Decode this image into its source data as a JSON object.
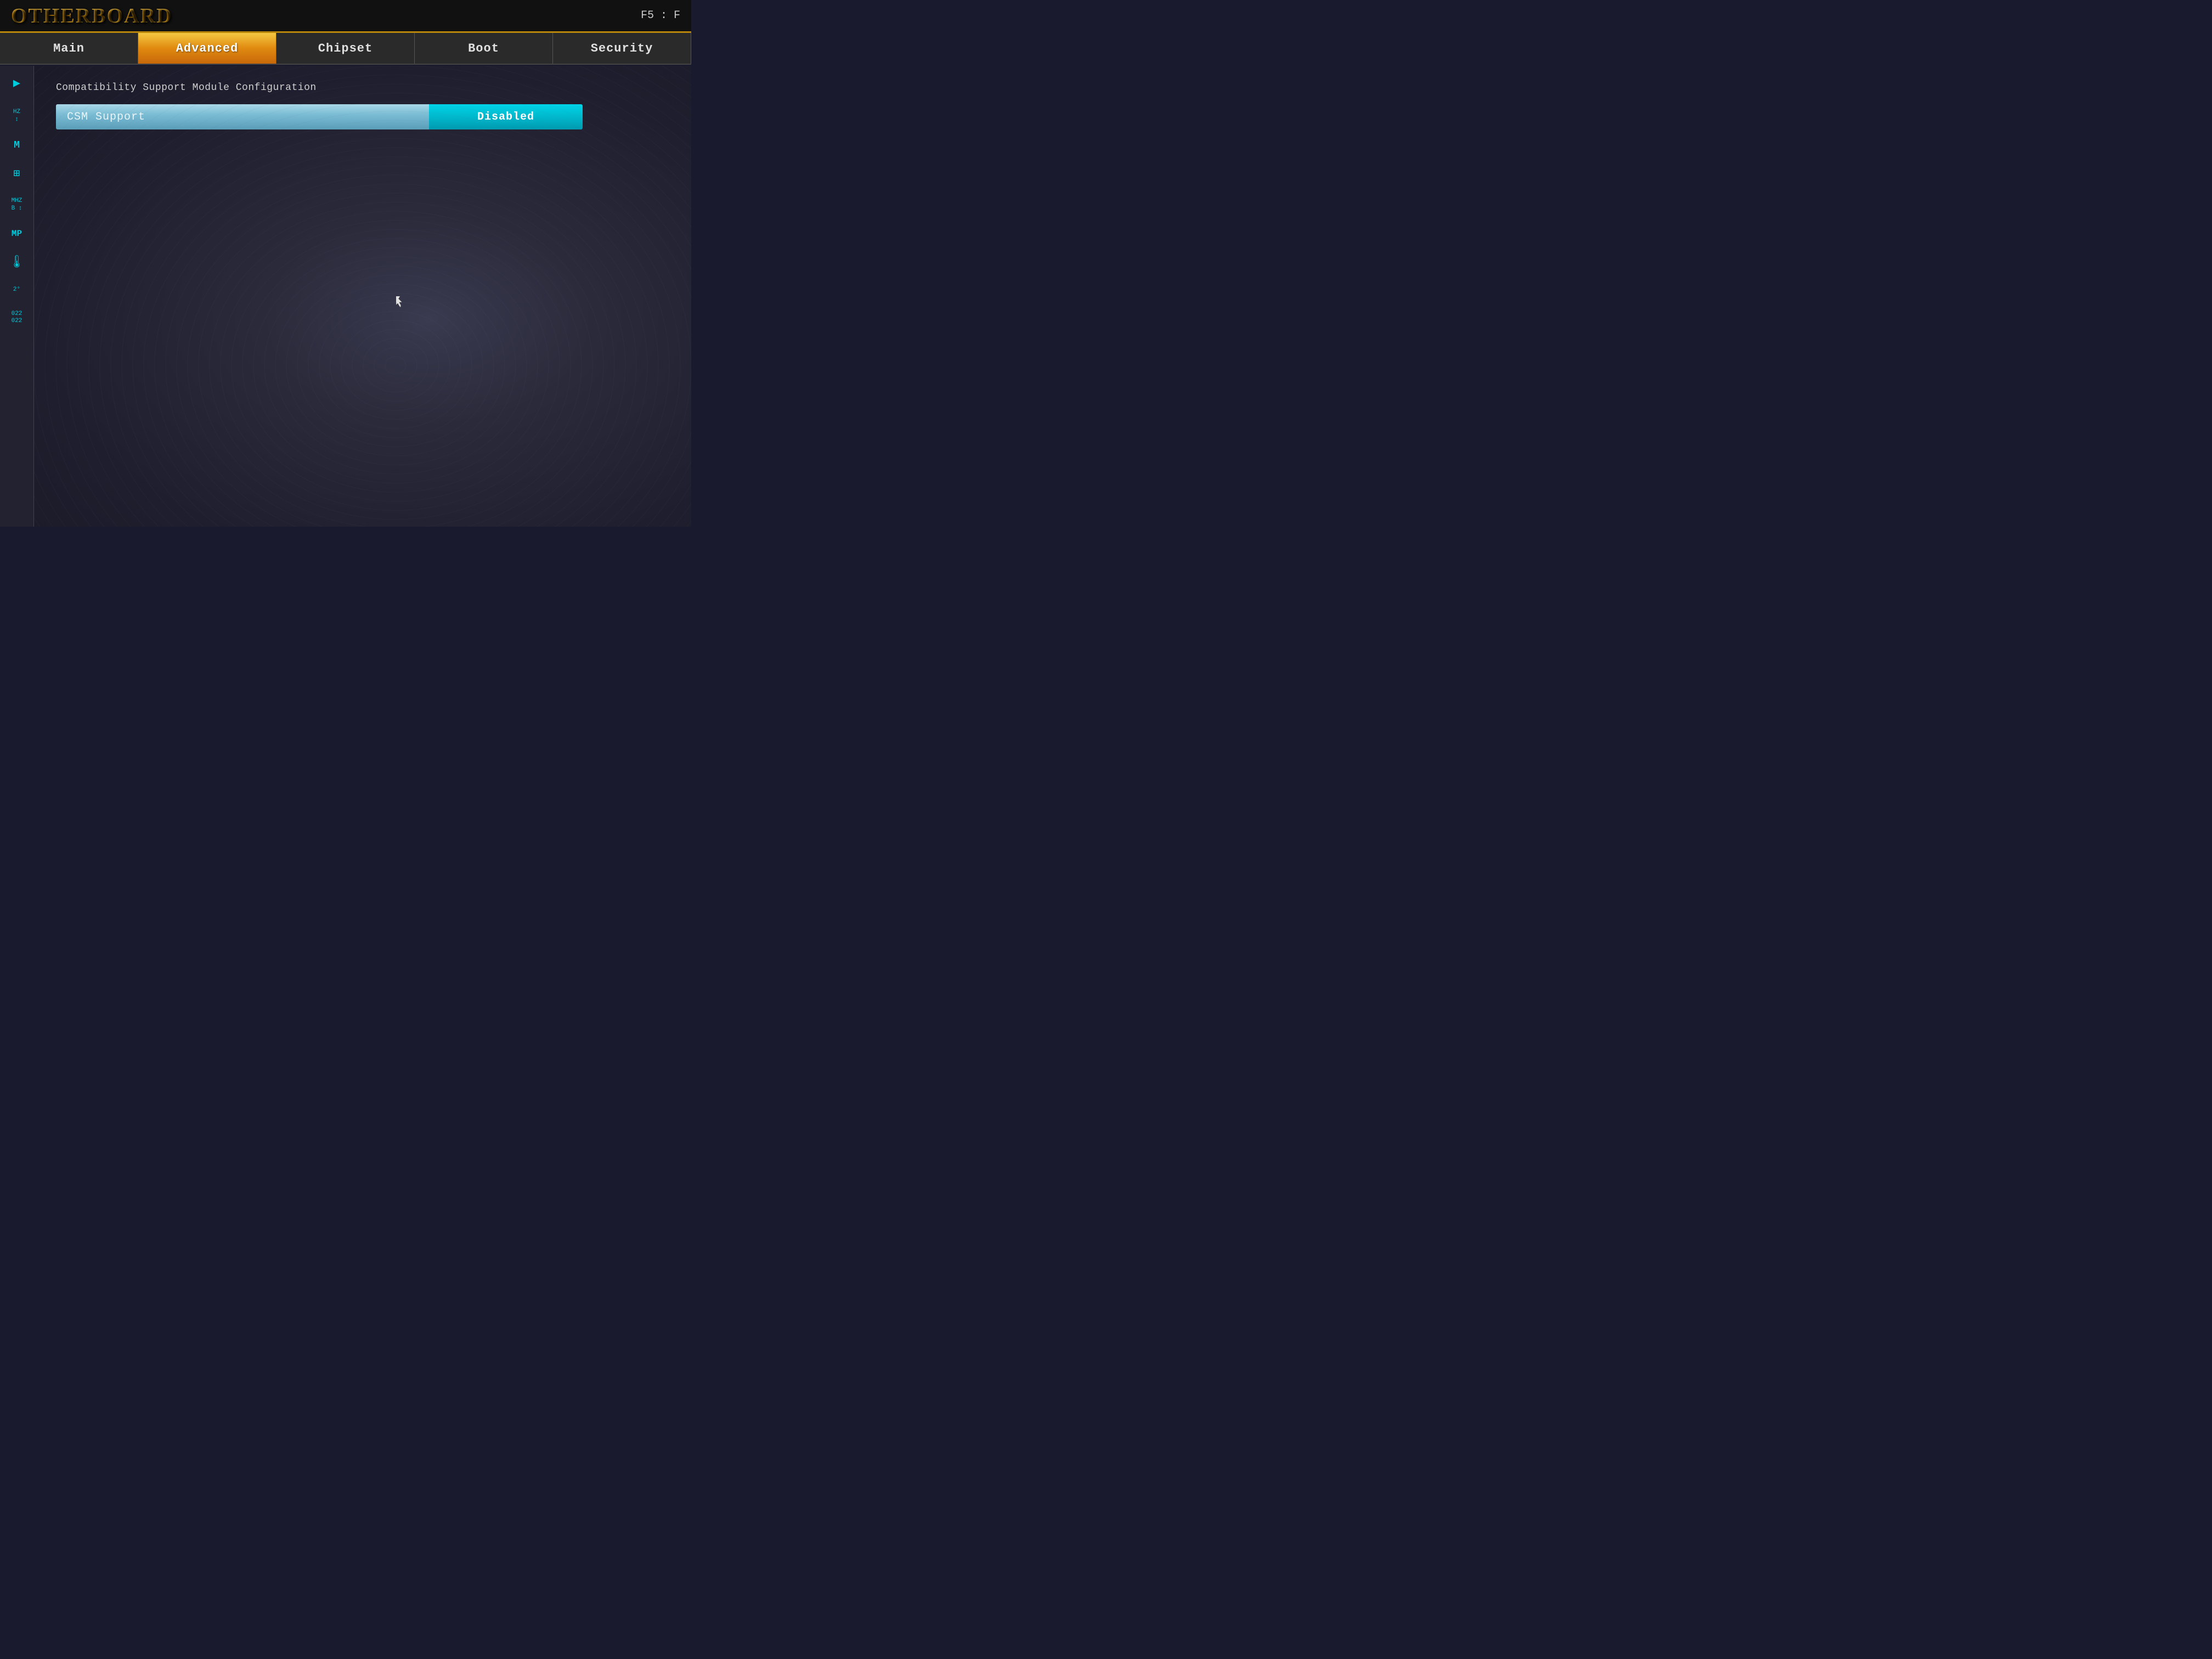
{
  "header": {
    "logo": "OTHERBOARD",
    "shortcut": "F5 : F"
  },
  "tabs": [
    {
      "id": "main",
      "label": "Main",
      "active": false
    },
    {
      "id": "advanced",
      "label": "Advanced",
      "active": true
    },
    {
      "id": "chipset",
      "label": "Chipset",
      "active": false
    },
    {
      "id": "boot",
      "label": "Boot",
      "active": false
    },
    {
      "id": "security",
      "label": "Security",
      "active": false
    }
  ],
  "sidebar": {
    "items": [
      {
        "id": "item1",
        "icon": "▶",
        "label": ""
      },
      {
        "id": "item2",
        "icon": "HZ\n↕",
        "label": ""
      },
      {
        "id": "item3",
        "icon": "M",
        "label": ""
      },
      {
        "id": "item4",
        "icon": "⊞",
        "label": ""
      },
      {
        "id": "item5",
        "icon": "MHZ\nB ↕",
        "label": ""
      },
      {
        "id": "item6",
        "icon": "MP",
        "label": ""
      },
      {
        "id": "item7",
        "icon": "🌡",
        "label": ""
      },
      {
        "id": "item8",
        "icon": "2°",
        "label": ""
      },
      {
        "id": "item9",
        "icon": "022\n022",
        "label": ""
      }
    ]
  },
  "main": {
    "section_title": "Compatibility Support Module Configuration",
    "csm_label": "CSM Support",
    "csm_value": "Disabled"
  }
}
